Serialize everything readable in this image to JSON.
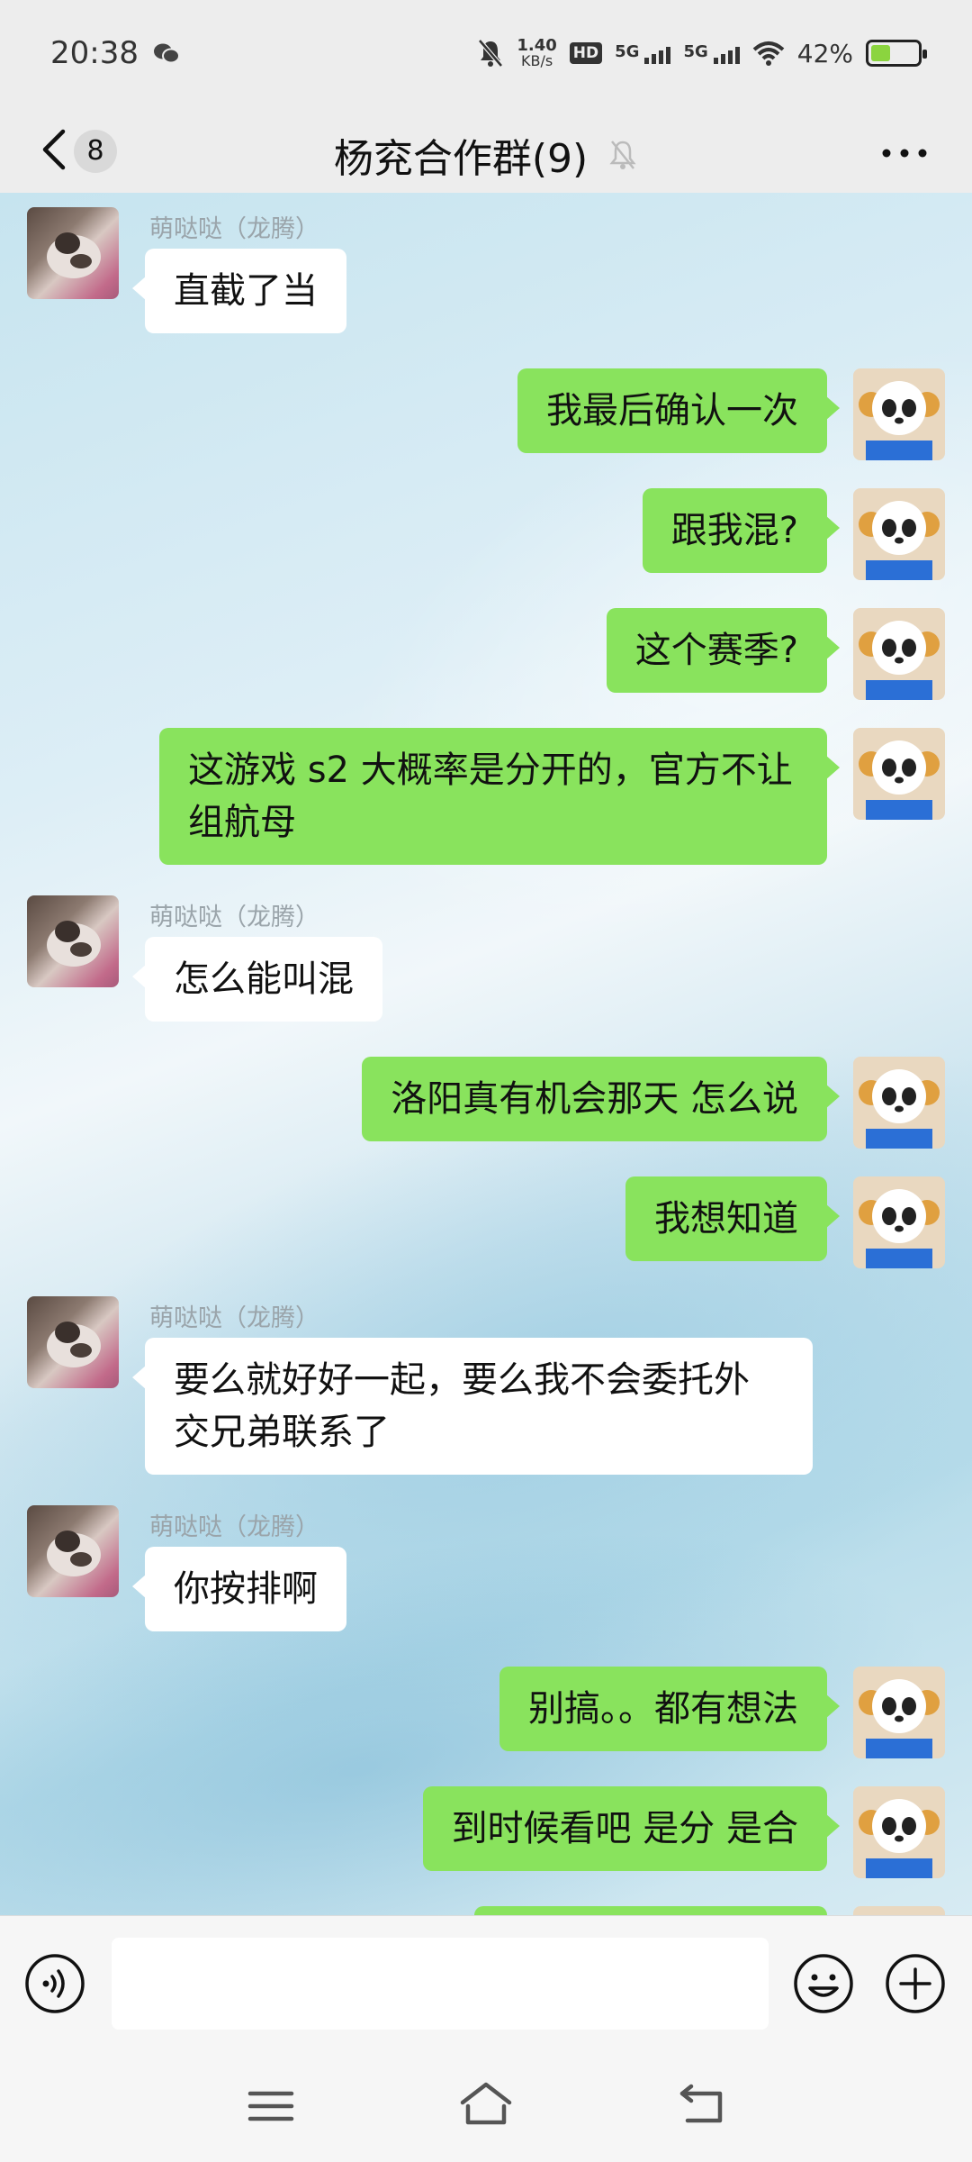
{
  "status_bar": {
    "time": "20:38",
    "speed_value": "1.40",
    "speed_unit": "KB/s",
    "hd_label": "HD",
    "sim1": "5G",
    "sim2": "5G",
    "battery_text": "42%",
    "battery_level": 0.42
  },
  "header": {
    "back_count": "8",
    "title": "杨兖合作群(9)"
  },
  "messages": {
    "m1": {
      "sender": "萌哒哒（龙腾）",
      "text": "直截了当"
    },
    "m2": {
      "text": "我最后确认一次"
    },
    "m3": {
      "text": "跟我混?"
    },
    "m4": {
      "text": "这个赛季?"
    },
    "m5": {
      "text": "这游戏 s2 大概率是分开的，官方不让组航母"
    },
    "m6": {
      "sender": "萌哒哒（龙腾）",
      "text": "怎么能叫混"
    },
    "m7": {
      "text": "洛阳真有机会那天 怎么说"
    },
    "m8": {
      "text": "我想知道"
    },
    "m9": {
      "sender": "萌哒哒（龙腾）",
      "text": "要么就好好一起，要么我不会委托外交兄弟联系了"
    },
    "m10": {
      "sender": "萌哒哒（龙腾）",
      "text": "你按排啊"
    },
    "m11": {
      "text": "别搞。。都有想法"
    },
    "m12": {
      "text": "到时候看吧 是分 是合"
    }
  },
  "input": {
    "value": ""
  },
  "colors": {
    "outgoing_bubble": "#89e35d",
    "incoming_bubble": "#ffffff",
    "background": "#ededed"
  }
}
